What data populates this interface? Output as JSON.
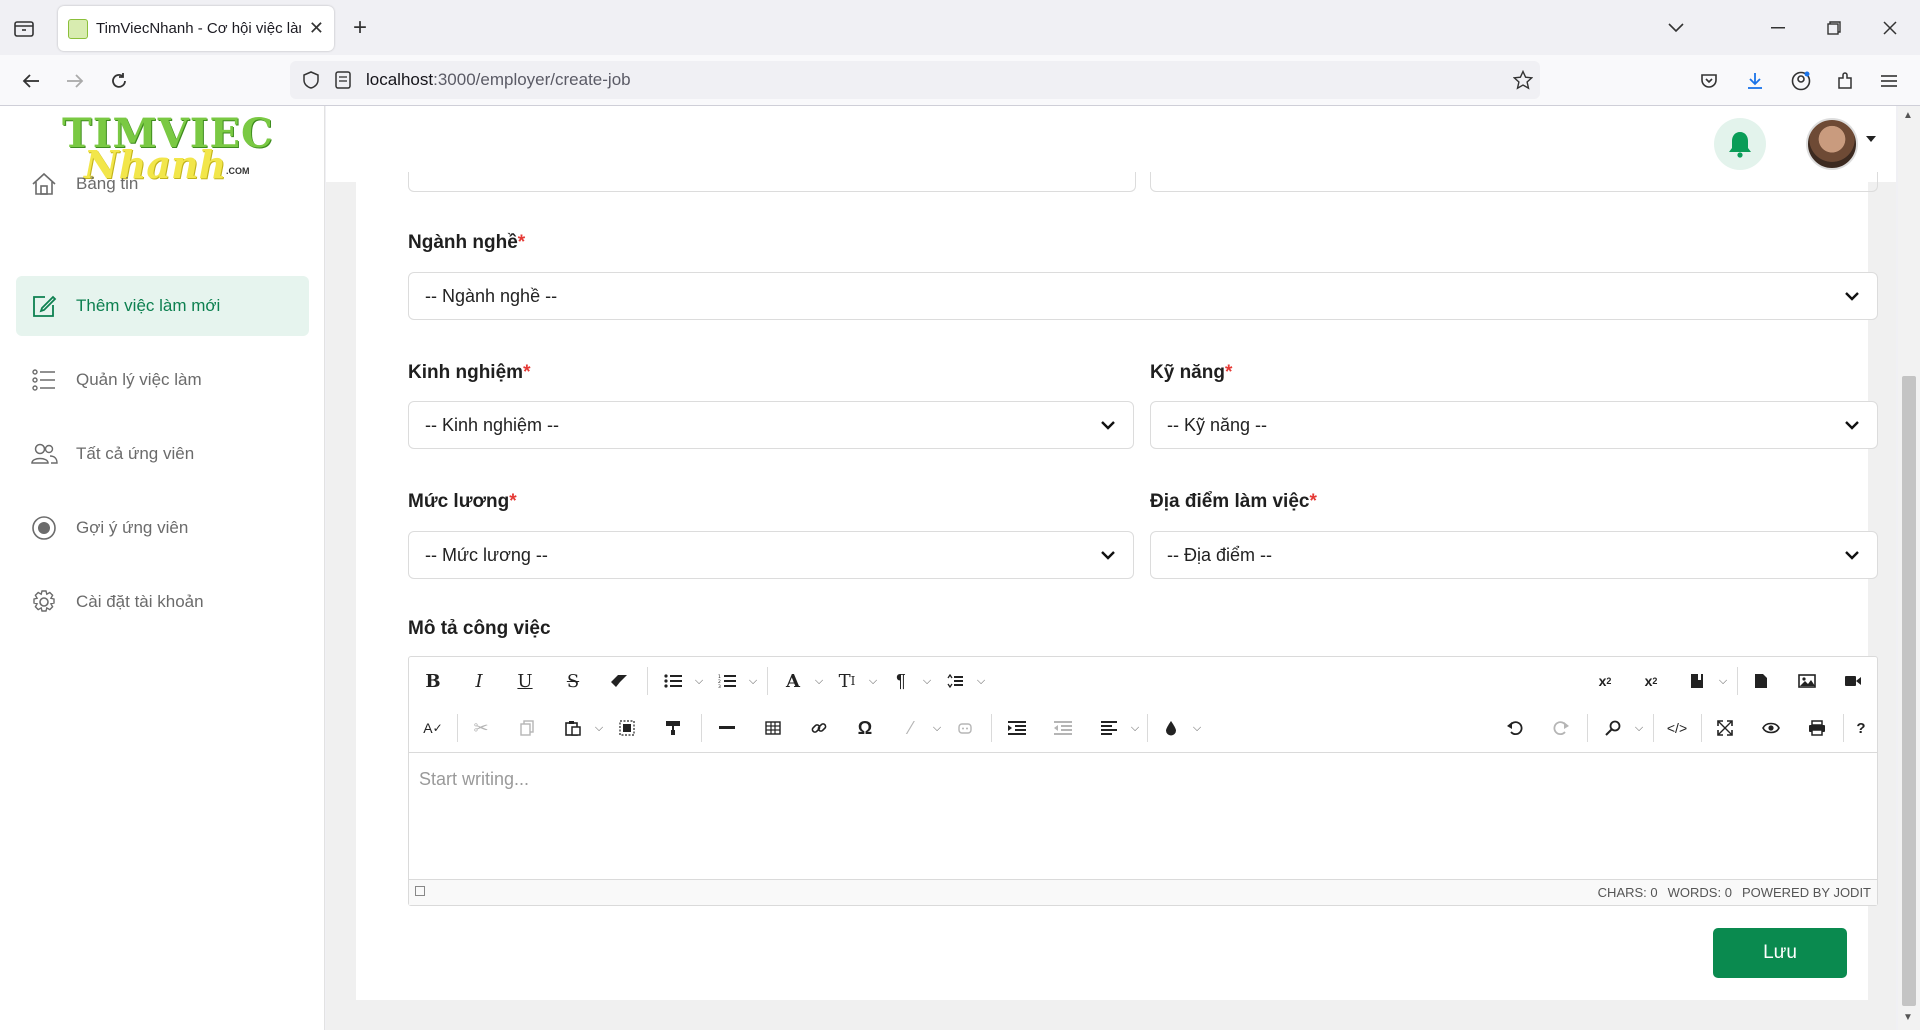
{
  "browser": {
    "tab_title": "TimViecNhanh - Cơ hội việc làm",
    "url_host": "localhost",
    "url_path": ":3000/employer/create-job"
  },
  "logo": {
    "line1": "TIMVIEC",
    "line2": "Nhanh",
    "suffix": ".COM"
  },
  "sidebar": {
    "items": [
      {
        "label": "Bảng tin",
        "icon": "home-icon"
      },
      {
        "label": "Thêm việc làm mới",
        "icon": "edit-icon",
        "active": true
      },
      {
        "label": "Quản lý việc làm",
        "icon": "list-icon"
      },
      {
        "label": "Tất cả ứng viên",
        "icon": "users-icon"
      },
      {
        "label": "Gợi ý ứng viên",
        "icon": "thumb-icon"
      },
      {
        "label": "Cài đặt tài khoản",
        "icon": "gear-icon"
      }
    ]
  },
  "form": {
    "industry": {
      "label": "Ngành nghề",
      "placeholder": "-- Ngành nghề --"
    },
    "experience": {
      "label": "Kinh nghiệm",
      "placeholder": "-- Kinh nghiệm --"
    },
    "skills": {
      "label": "Kỹ năng",
      "placeholder": "-- Kỹ năng --"
    },
    "salary": {
      "label": "Mức lương",
      "placeholder": "-- Mức lương --"
    },
    "location": {
      "label": "Địa điểm làm việc",
      "placeholder": "-- Địa điểm --"
    },
    "description": {
      "label": "Mô tả công việc",
      "placeholder": "Start writing..."
    },
    "required_mark": "*"
  },
  "editor": {
    "chars": "CHARS: 0",
    "words": "WORDS: 0",
    "powered": "POWERED BY JODIT"
  },
  "save_label": "Lưu",
  "colors": {
    "accent": "#0a8a4f",
    "active_bg": "#e6f4ee",
    "required": "#e53935"
  }
}
